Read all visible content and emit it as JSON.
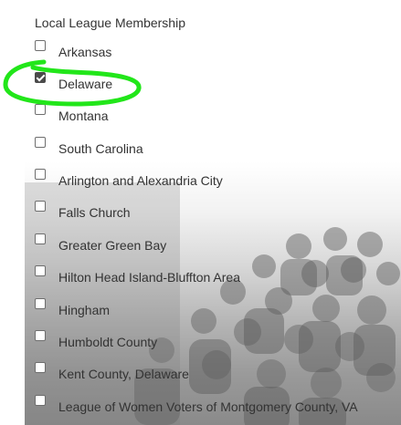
{
  "form": {
    "heading": "Local League Membership",
    "options": [
      {
        "label": "Arkansas",
        "checked": false
      },
      {
        "label": "Delaware",
        "checked": true
      },
      {
        "label": "Montana",
        "checked": false
      },
      {
        "label": "South Carolina",
        "checked": false
      },
      {
        "label": "Arlington and Alexandria City",
        "checked": false
      },
      {
        "label": "Falls Church",
        "checked": false
      },
      {
        "label": "Greater Green Bay",
        "checked": false
      },
      {
        "label": "Hilton Head Island-Bluffton Area",
        "checked": false
      },
      {
        "label": "Hingham",
        "checked": false
      },
      {
        "label": "Humboldt County",
        "checked": false
      },
      {
        "label": "Kent County, Delaware",
        "checked": false
      },
      {
        "label": "League of Women Voters of Montgomery County, VA",
        "checked": false
      }
    ]
  },
  "colors": {
    "text": "#333333",
    "checkbox_checked": "#4a4a4a",
    "highlight": "#22e61a"
  }
}
